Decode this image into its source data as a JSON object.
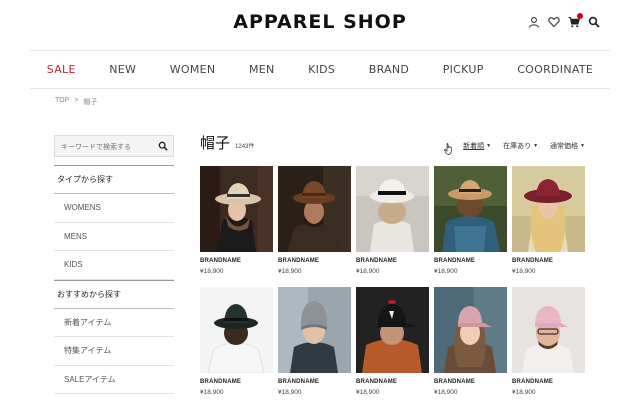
{
  "header": {
    "logo": "APPAREL SHOP",
    "icons": [
      "user-icon",
      "heart-icon",
      "cart-icon",
      "search-icon"
    ]
  },
  "nav": [
    "SALE",
    "NEW",
    "WOMEN",
    "MEN",
    "KIDS",
    "BRAND",
    "PICKUP",
    "COORDINATE"
  ],
  "breadcrumb": {
    "home": "TOP",
    "sep": ">",
    "current": "帽子"
  },
  "sidebar": {
    "search_placeholder": "キーワードで検索する",
    "section1": {
      "title": "タイプから探す",
      "items": [
        "WOMENS",
        "MENS",
        "KIDS"
      ]
    },
    "section2": {
      "title": "おすすめから探す",
      "items": [
        "新着アイテム",
        "特集アイテム",
        "SALEアイテム"
      ]
    }
  },
  "main": {
    "title": "帽子",
    "count": "1243件",
    "sorts": [
      "新着順",
      "在庫あり",
      "通常価格"
    ]
  },
  "products": [
    {
      "brand": "BRANDNAME",
      "price": "¥18,900"
    },
    {
      "brand": "BRANDNAME",
      "price": "¥18,900"
    },
    {
      "brand": "BRANDNAME",
      "price": "¥18,900"
    },
    {
      "brand": "BRANDNAME",
      "price": "¥18,900"
    },
    {
      "brand": "BRANDNAME",
      "price": "¥18,900"
    },
    {
      "brand": "BRANDNAME",
      "price": "¥18,900"
    },
    {
      "brand": "BRANDNAME",
      "price": "¥18,900"
    },
    {
      "brand": "BRANDNAME",
      "price": "¥18,900"
    },
    {
      "brand": "BRANDNAME",
      "price": "¥18,900"
    },
    {
      "brand": "BRANDNAME",
      "price": "¥18,900"
    }
  ],
  "colors": {
    "sale": "#c1272d",
    "cart_badge": "#d0021b"
  }
}
